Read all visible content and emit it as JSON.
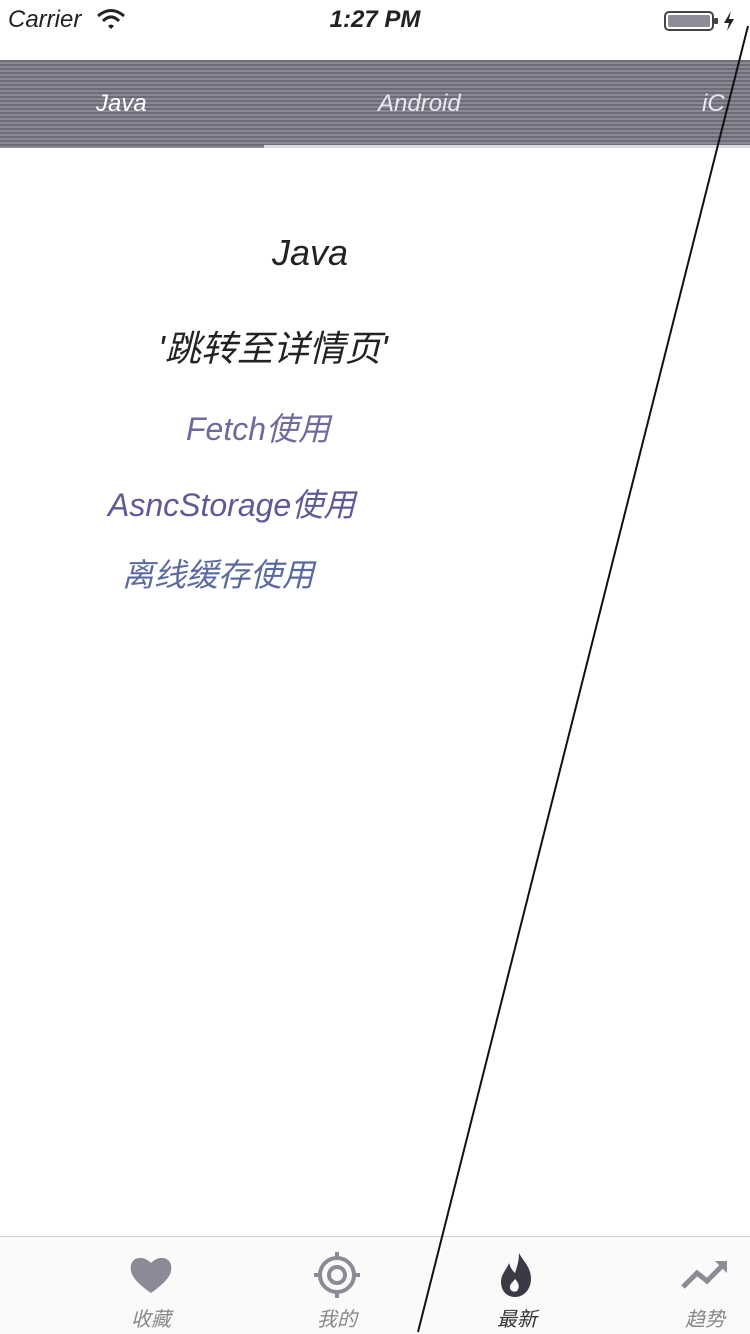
{
  "status_bar": {
    "carrier": "Carrier",
    "time": "1:27 PM"
  },
  "top_tabs": [
    {
      "label": "Java",
      "active": true
    },
    {
      "label": "Android",
      "active": false
    },
    {
      "label": "iC",
      "active": false
    }
  ],
  "content": {
    "title": "Java",
    "detail_link": "'跳转至详情页'",
    "fetch_link": "Fetch使用",
    "storage_link": "AsncStorage使用",
    "cache_link": "离线缓存使用"
  },
  "bottom_tabs": [
    {
      "label": "收藏",
      "icon": "heart-icon",
      "active": false
    },
    {
      "label": "我的",
      "icon": "target-icon",
      "active": false
    },
    {
      "label": "最新",
      "icon": "flame-icon",
      "active": true
    },
    {
      "label": "趋势",
      "icon": "trending-up-icon",
      "active": false
    }
  ],
  "colors": {
    "tab_bar": "#7b7986",
    "link_purple": "#6e6a9e",
    "active_label": "#333333",
    "inactive_label": "#888888"
  }
}
